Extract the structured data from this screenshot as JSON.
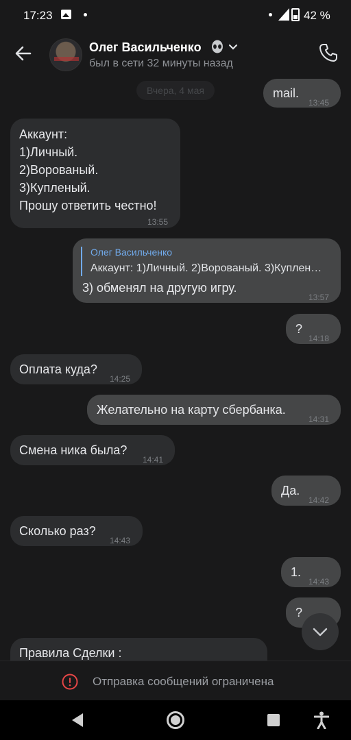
{
  "status_bar": {
    "time": "17:23",
    "battery": "42 %"
  },
  "header": {
    "name": "Олег Васильченко",
    "last_seen": "был в сети 32 минуты назад"
  },
  "chat": {
    "date_separator": "Вчера, 4 мая",
    "messages": [
      {
        "dir": "out",
        "text": "mail.",
        "time": "13:45"
      },
      {
        "dir": "in",
        "lines": [
          "Аккаунт:",
          "1)Личный.",
          "2)Ворованый.",
          "3)Купленый.",
          "Прошу ответить честно!"
        ],
        "time": "13:55"
      },
      {
        "dir": "out",
        "reply_author": "Олег Васильченко",
        "reply_text": "Аккаунт: 1)Личный. 2)Ворованый. 3)Купленый. Прошу ответить честно!",
        "text": "3) обменял на другую игру.",
        "time": "13:57"
      },
      {
        "dir": "out",
        "text": "?",
        "time": "14:18"
      },
      {
        "dir": "in",
        "text": "Оплата куда?",
        "time": "14:25"
      },
      {
        "dir": "out",
        "text": "Желательно на карту сбербанка.",
        "time": "14:31"
      },
      {
        "dir": "in",
        "text": "Смена ника была?",
        "time": "14:41"
      },
      {
        "dir": "out",
        "text": "Да.",
        "time": "14:42"
      },
      {
        "dir": "in",
        "text": "Сколько раз?",
        "time": "14:43"
      },
      {
        "dir": "out",
        "text": "1.",
        "time": "14:43"
      },
      {
        "dir": "out",
        "text": "?",
        "time": ""
      },
      {
        "dir": "in",
        "text": "Правила Сделки :",
        "time": ""
      }
    ]
  },
  "bottom_bar": {
    "restricted_text": "Отправка сообщений ограничена"
  },
  "icons": {
    "back": "arrow-left-icon",
    "call": "phone-icon",
    "emoji": "alien-icon",
    "expand": "chevron-down-icon",
    "scroll_down": "chevron-down-icon",
    "warning": "exclamation-circle-icon"
  },
  "colors": {
    "background": "#19191a",
    "incoming_bubble": "#2c2d2f",
    "outgoing_bubble": "#454647",
    "reply_accent": "#71aaeb",
    "warning_red": "#e64646"
  }
}
